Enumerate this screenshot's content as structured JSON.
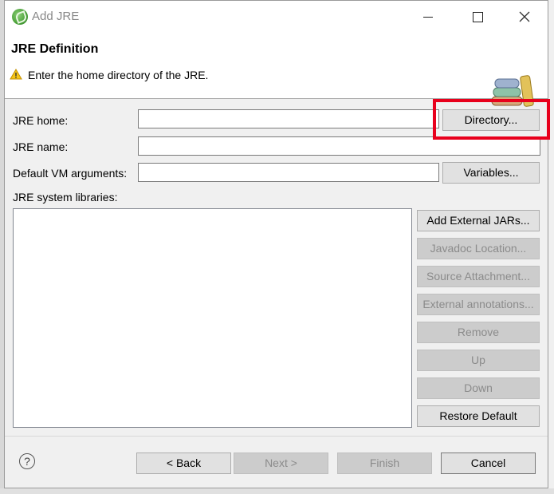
{
  "window": {
    "title": "Add JRE"
  },
  "header": {
    "title": "JRE Definition",
    "message": "Enter the home directory of the JRE."
  },
  "form": {
    "jre_home_label": "JRE home:",
    "jre_home_value": "",
    "jre_name_label": "JRE name:",
    "jre_name_value": "",
    "vm_args_label": "Default VM arguments:",
    "vm_args_value": "",
    "system_libraries_label": "JRE system libraries:",
    "directory_button": "Directory...",
    "variables_button": "Variables..."
  },
  "library_buttons": [
    {
      "label": "Add External JARs...",
      "enabled": true
    },
    {
      "label": "Javadoc Location...",
      "enabled": false
    },
    {
      "label": "Source Attachment...",
      "enabled": false
    },
    {
      "label": "External annotations...",
      "enabled": false
    },
    {
      "label": "Remove",
      "enabled": false
    },
    {
      "label": "Up",
      "enabled": false
    },
    {
      "label": "Down",
      "enabled": false
    },
    {
      "label": "Restore Default",
      "enabled": true
    }
  ],
  "footer": {
    "back": "< Back",
    "next": "Next >",
    "finish": "Finish",
    "cancel": "Cancel"
  },
  "colors": {
    "highlight": "#e8001c",
    "dialog_bg": "#f0f0f0"
  }
}
